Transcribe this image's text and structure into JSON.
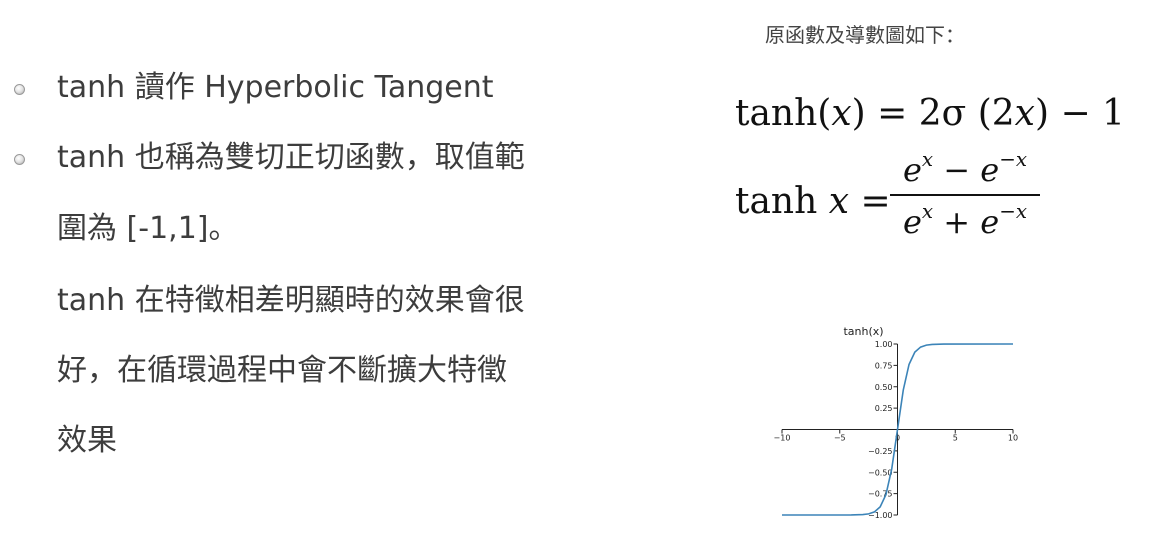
{
  "bullets": [
    {
      "text": "tanh 讀作 Hyperbolic Tangent"
    },
    {
      "text": "tanh 也稱為雙切正切函數，取值範"
    }
  ],
  "lines": [
    "圍為 [-1,1]。",
    "tanh 在特徵相差明顯時的效果會很",
    "好，在循環過程中會不斷擴大特徵",
    "效果"
  ],
  "caption": "原函數及導數圖如下：",
  "formula1": {
    "lhs": "tanh(",
    "var": "x",
    "mid": ") = 2σ (2",
    "var2": "x",
    "rhs": ") − 1"
  },
  "formula2": {
    "lhs": "tanh ",
    "var": "x",
    "eq": " =",
    "numerator": {
      "a": "e",
      "a_exp": "x",
      "op": " − ",
      "b": "e",
      "b_exp": "−x"
    },
    "denominator": {
      "a": "e",
      "a_exp": "x",
      "op": " + ",
      "b": "e",
      "b_exp": "−x"
    }
  },
  "chart_data": {
    "type": "line",
    "title": "tanh(x)",
    "xlim": [
      -10,
      10
    ],
    "ylim": [
      -1,
      1
    ],
    "x_ticks": [
      -10,
      -5,
      0,
      5,
      10
    ],
    "y_ticks": [
      1.0,
      0.75,
      0.5,
      0.25,
      -0.25,
      -0.5,
      -0.75,
      -1.0
    ],
    "x_tick_labels": [
      "−10",
      "−5",
      "0",
      "5",
      "10"
    ],
    "y_tick_labels": [
      "1.00",
      "0.75",
      "0.50",
      "0.25",
      "−0.25",
      "−0.50",
      "−0.75",
      "−1.00"
    ],
    "series": [
      {
        "color": "#3c84b8",
        "x": [
          -10,
          -4,
          -3,
          -2.5,
          -2,
          -1.5,
          -1,
          -0.5,
          0,
          0.5,
          1,
          1.5,
          2,
          2.5,
          3,
          4,
          10
        ],
        "y": [
          -1.0,
          -0.999,
          -0.995,
          -0.987,
          -0.964,
          -0.905,
          -0.762,
          -0.462,
          0.0,
          0.462,
          0.762,
          0.905,
          0.964,
          0.987,
          0.995,
          0.999,
          1.0
        ]
      }
    ],
    "grid": false
  }
}
